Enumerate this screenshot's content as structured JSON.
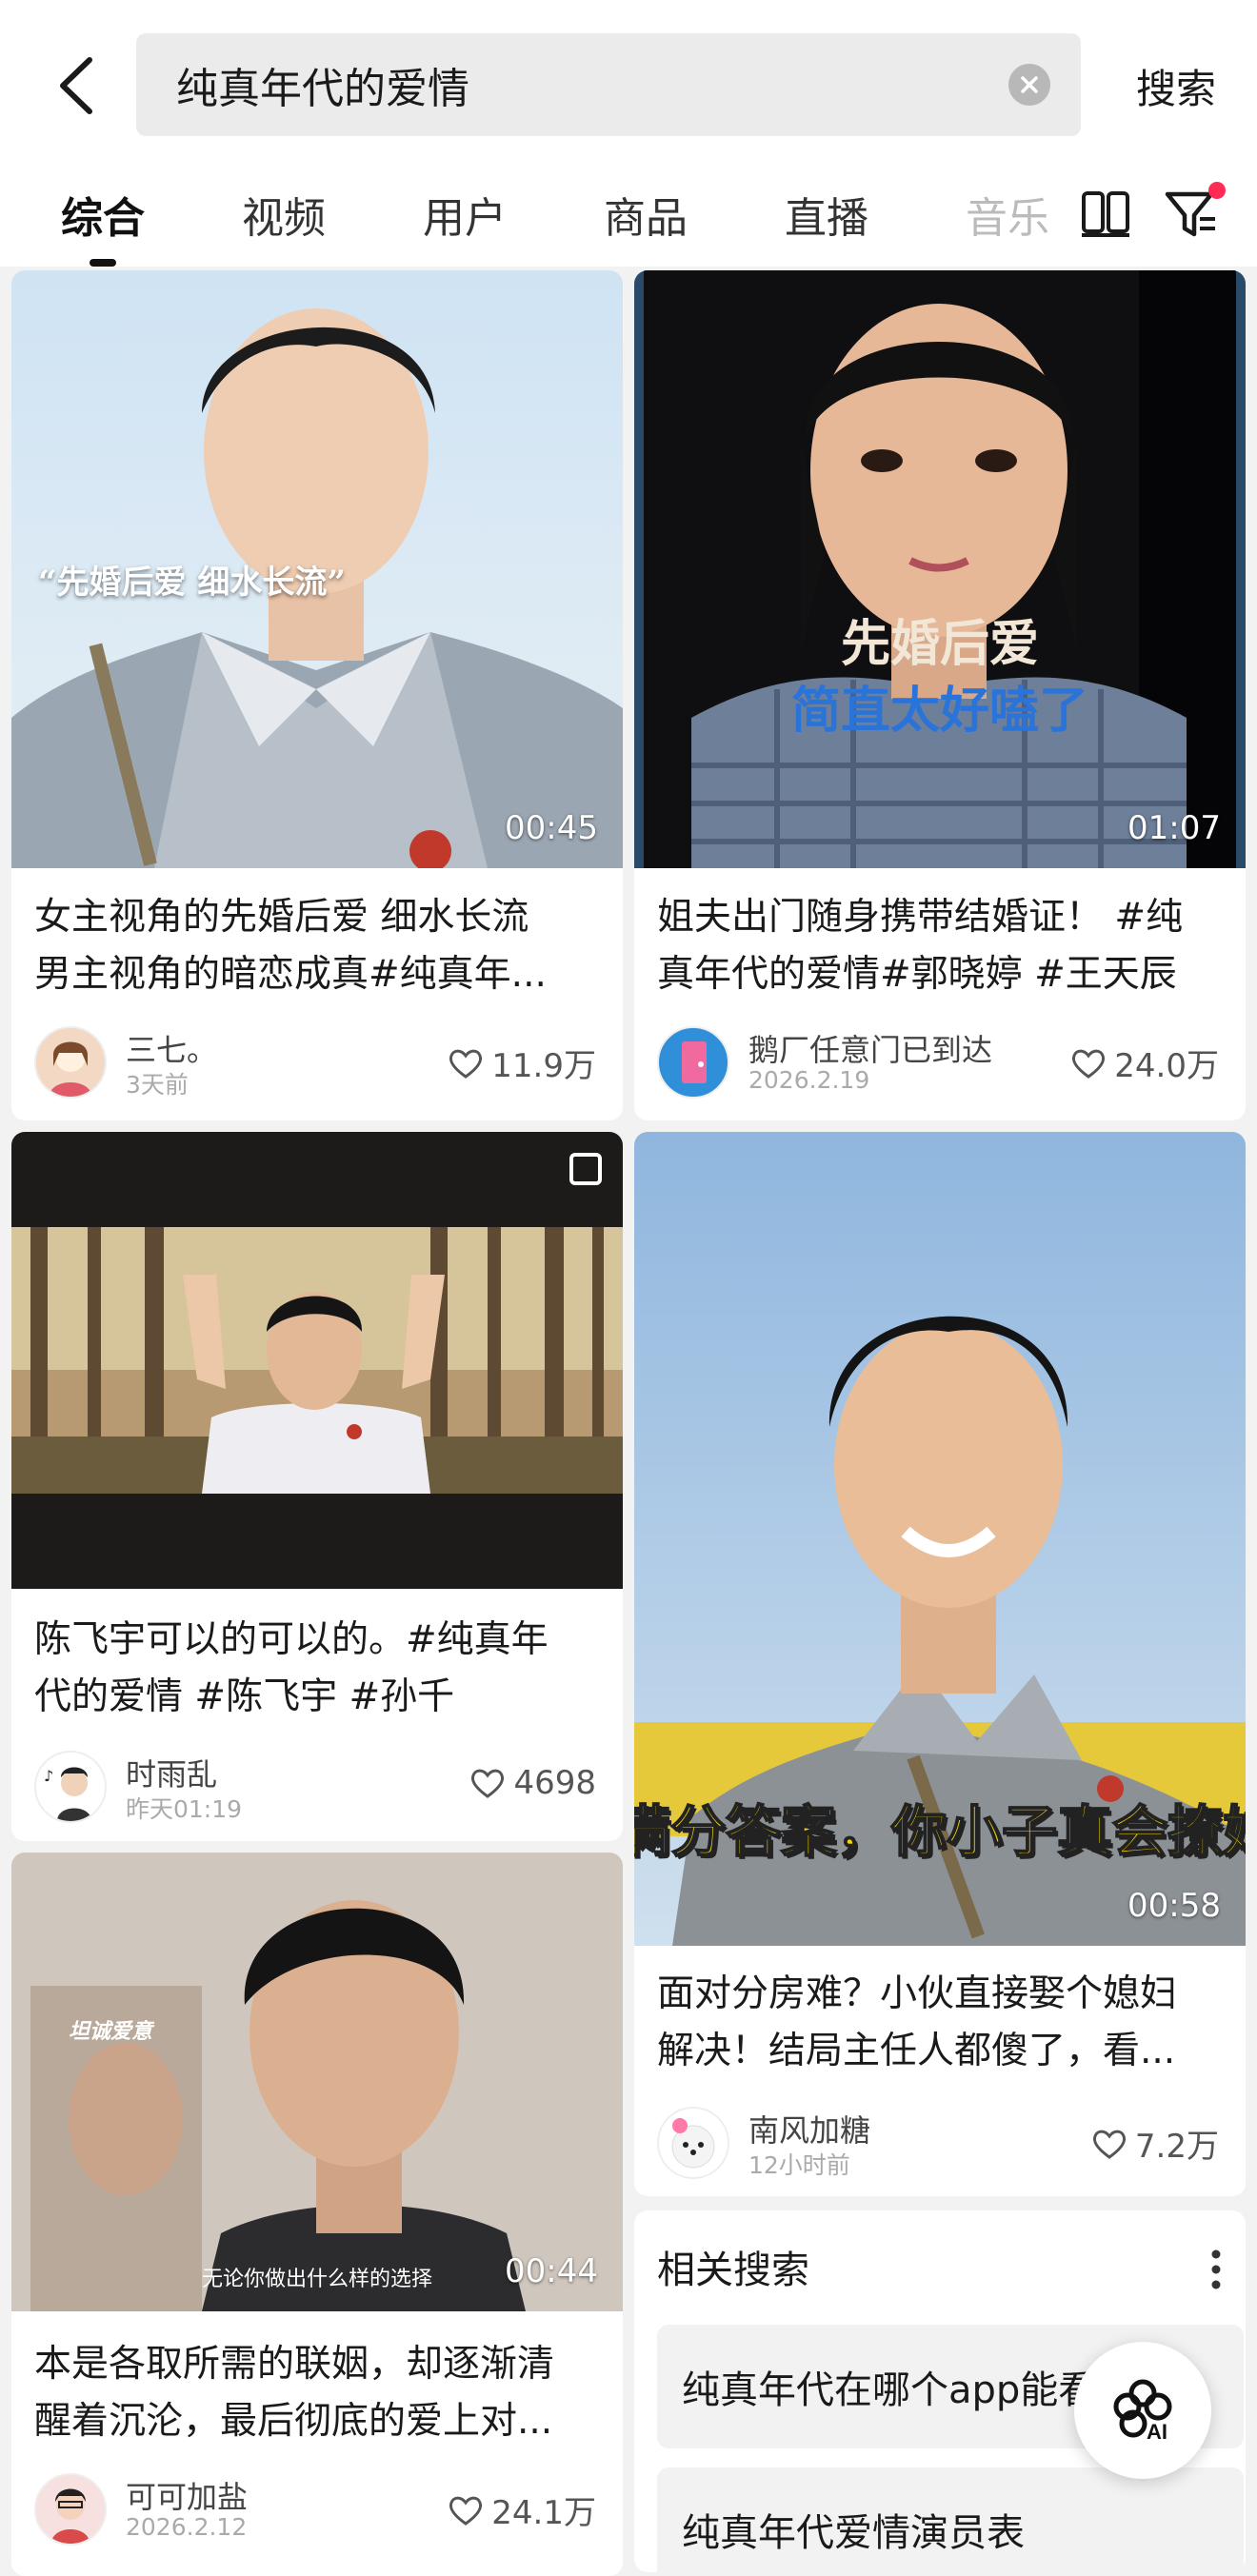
{
  "search": {
    "query": "纯真年代的爱情",
    "submit_label": "搜索"
  },
  "tabs": [
    {
      "label": "综合"
    },
    {
      "label": "视频"
    },
    {
      "label": "用户"
    },
    {
      "label": "商品"
    },
    {
      "label": "直播"
    },
    {
      "label": "音乐"
    }
  ],
  "accent_color": "#fe2c55",
  "cards": [
    {
      "overlay_text": "“先婚后爱 细水长流”",
      "duration": "00:45",
      "title_line1": "女主视角的先婚后爱 细水长流",
      "title_line2": "男主视角的暗恋成真#纯真年...",
      "author": "三七。",
      "time": "3天前",
      "likes": "11.9万"
    },
    {
      "overlay_line1": "先婚后爱",
      "overlay_line2": "简直太好嗑了",
      "duration": "01:07",
      "title_line1": "姐夫出门随身携带结婚证！ #纯",
      "title_line2": "真年代的爱情#郭晓婷 #王天辰",
      "author": "鹅厂任意门已到达",
      "time": "2026.2.19",
      "likes": "24.0万"
    },
    {
      "title_line1": "陈飞宇可以的可以的。#纯真年",
      "title_line2": "代的爱情 #陈飞宇 #孙千",
      "author": "时雨乱",
      "time": "昨天01:19",
      "likes": "4698"
    },
    {
      "overlay_text": "满分答案，你小子真会撩妹",
      "duration": "00:58",
      "title_line1": "面对分房难？小伙直接娶个媳妇",
      "title_line2": "解决！结局主任人都傻了，看...",
      "author": "南风加糖",
      "time": "12小时前",
      "likes": "7.2万"
    },
    {
      "overlay_text": "无论你做出什么样的选择",
      "duration": "00:44",
      "title_line1": "本是各取所需的联姻，却逐渐清",
      "title_line2": "醒着沉沦，最后彻底的爱上对...",
      "author": "可可加盐",
      "time": "2026.2.12",
      "likes": "24.1万"
    }
  ],
  "related": {
    "title": "相关搜索",
    "items": [
      "纯真年代在哪个app能看",
      "纯真年代爱情演员表"
    ]
  },
  "ai_button": {
    "label": "AI"
  }
}
